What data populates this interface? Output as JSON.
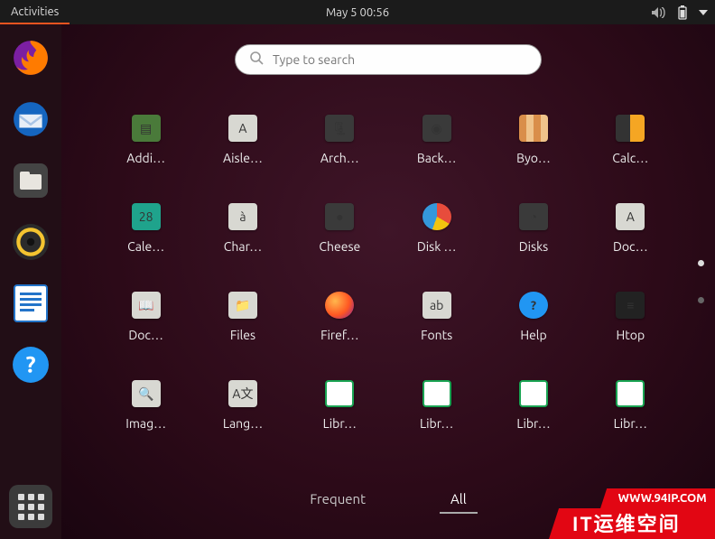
{
  "topbar": {
    "activities": "Activities",
    "clock": "May 5  00:56"
  },
  "search": {
    "placeholder": "Type to search"
  },
  "dock": [
    {
      "name": "firefox"
    },
    {
      "name": "thunderbird"
    },
    {
      "name": "files"
    },
    {
      "name": "rhythmbox"
    },
    {
      "name": "libreoffice-writer"
    },
    {
      "name": "help"
    }
  ],
  "apps": [
    {
      "label": "Addi…",
      "tile": "t-green",
      "glyph": "▤"
    },
    {
      "label": "Aisle…",
      "tile": "",
      "glyph": "A"
    },
    {
      "label": "Arch…",
      "tile": "t-dark",
      "glyph": "🗜"
    },
    {
      "label": "Back…",
      "tile": "t-dark",
      "glyph": "◉"
    },
    {
      "label": "Byo…",
      "tile": "t-byobu",
      "glyph": ""
    },
    {
      "label": "Calc…",
      "tile": "t-calc",
      "glyph": ""
    },
    {
      "label": "Cale…",
      "tile": "t-cal",
      "glyph": "28"
    },
    {
      "label": "Char…",
      "tile": "",
      "glyph": "à"
    },
    {
      "label": "Cheese",
      "tile": "t-dark",
      "glyph": "●"
    },
    {
      "label": "Disk …",
      "tile": "t-disk",
      "glyph": ""
    },
    {
      "label": "Disks",
      "tile": "t-dark",
      "glyph": "◔"
    },
    {
      "label": "Doc…",
      "tile": "",
      "glyph": "A"
    },
    {
      "label": "Doc…",
      "tile": "",
      "glyph": "📖"
    },
    {
      "label": "Files",
      "tile": "",
      "glyph": "📁"
    },
    {
      "label": "Firef…",
      "tile": "t-firefox",
      "glyph": ""
    },
    {
      "label": "Fonts",
      "tile": "",
      "glyph": "ab"
    },
    {
      "label": "Help",
      "tile": "t-help",
      "glyph": "?"
    },
    {
      "label": "Htop",
      "tile": "t-htop",
      "glyph": "≡"
    },
    {
      "label": "Imag…",
      "tile": "",
      "glyph": "🔍"
    },
    {
      "label": "Lang…",
      "tile": "",
      "glyph": "A文"
    },
    {
      "label": "Libr…",
      "tile": "t-lo",
      "glyph": ""
    },
    {
      "label": "Libr…",
      "tile": "t-lo",
      "glyph": ""
    },
    {
      "label": "Libr…",
      "tile": "t-lo",
      "glyph": ""
    },
    {
      "label": "Libr…",
      "tile": "t-lo",
      "glyph": ""
    }
  ],
  "tabs": {
    "frequent": "Frequent",
    "all": "All"
  },
  "footer": {
    "url": "WWW.94IP.COM",
    "cn": "IT运维空间"
  }
}
